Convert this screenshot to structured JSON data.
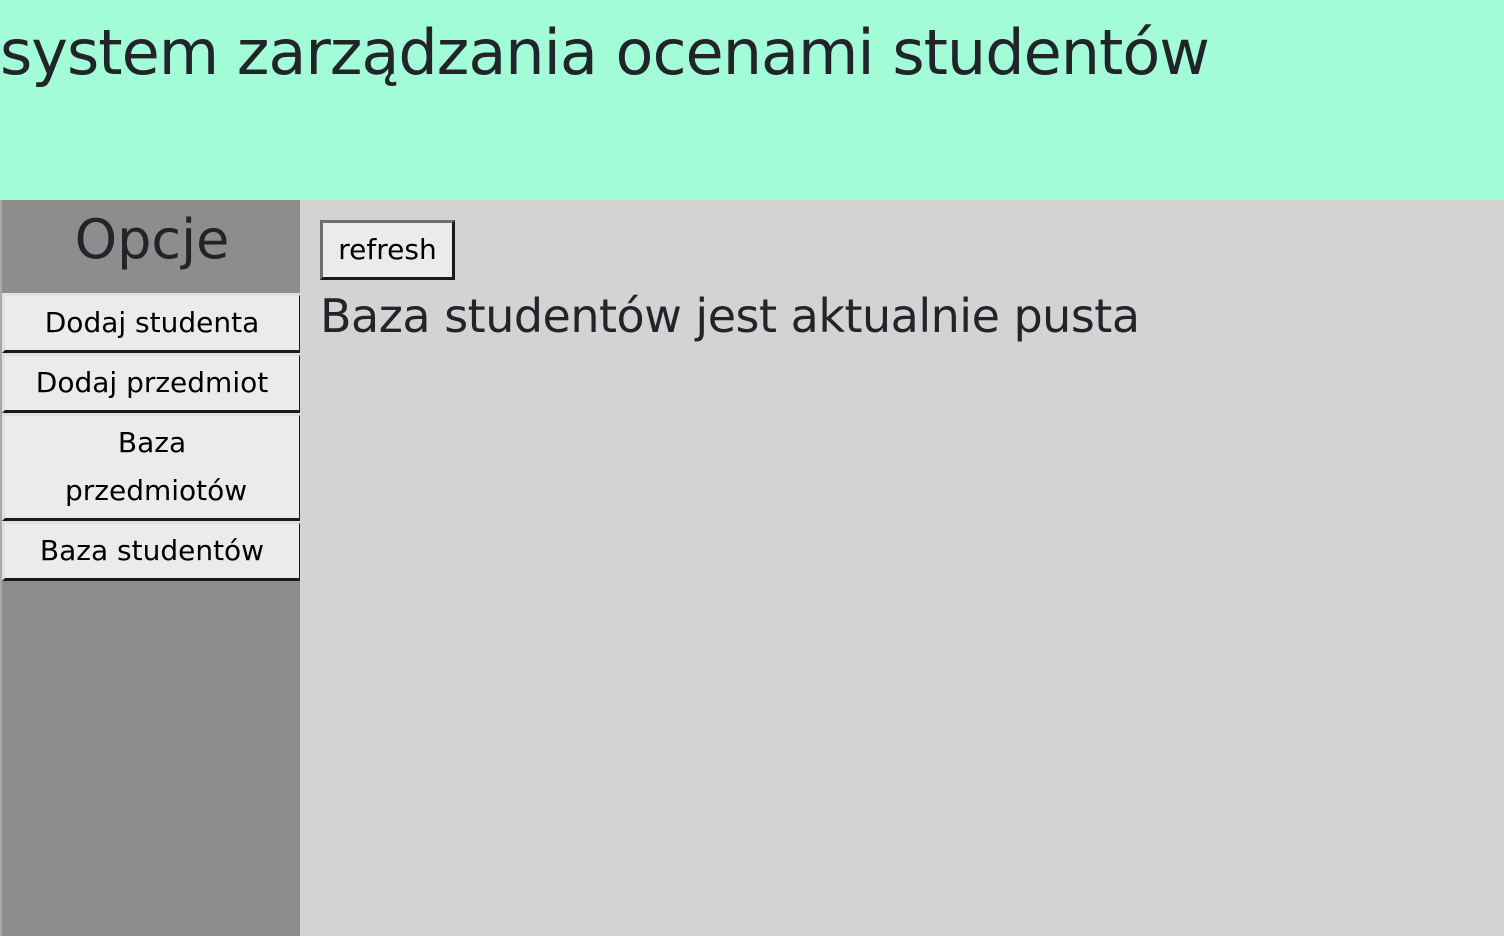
{
  "header": {
    "title": "system zarządzania ocenami studentów"
  },
  "sidebar": {
    "title": "Opcje",
    "items": [
      {
        "label": "Dodaj studenta"
      },
      {
        "label": "Dodaj przedmiot"
      },
      {
        "label": "Baza przedmiotów"
      },
      {
        "label": "Baza studentów"
      }
    ]
  },
  "main": {
    "refresh_label": "refresh",
    "empty_message": "Baza studentów jest aktualnie pusta"
  },
  "colors": {
    "header_bg": "#a2fcd8",
    "sidebar_bg": "#8e8c8c",
    "content_bg": "#d3d3d3",
    "button_bg": "#ebebeb",
    "text": "#212529"
  }
}
